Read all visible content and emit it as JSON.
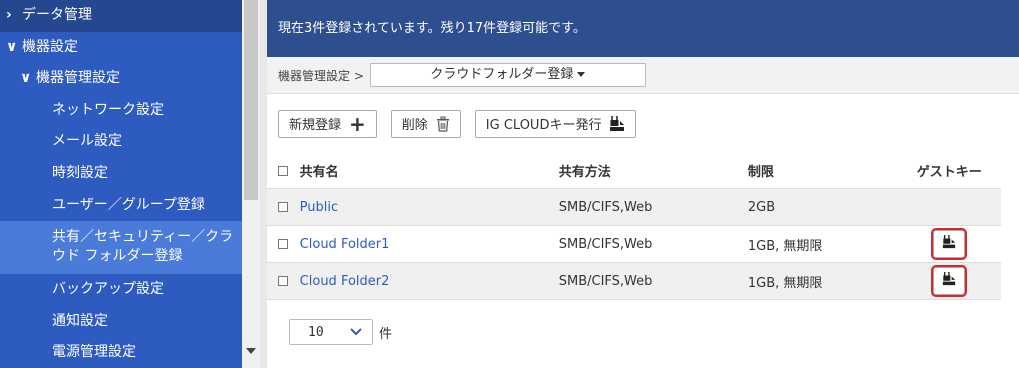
{
  "sidebar": {
    "items": [
      {
        "label": "データ管理",
        "chevron": "›"
      },
      {
        "label": "機器設定",
        "chevron": "∨"
      },
      {
        "label": "機器管理設定",
        "chevron": "∨"
      },
      {
        "label": "ネットワーク設定"
      },
      {
        "label": "メール設定"
      },
      {
        "label": "時刻設定"
      },
      {
        "label": "ユーザー／グループ登録"
      },
      {
        "label": "共有／セキュリティー／クラウド フォルダー登録"
      },
      {
        "label": "バックアップ設定"
      },
      {
        "label": "通知設定"
      },
      {
        "label": "電源管理設定"
      }
    ],
    "selected_index": 7
  },
  "banner": {
    "text": "現在3件登録されています。残り17件登録可能です。"
  },
  "breadcrumb": {
    "parent": "機器管理設定 >",
    "current": "クラウドフォルダー登録"
  },
  "toolbar": {
    "new_label": "新規登録",
    "new_icon": "+",
    "delete_label": "削除",
    "igcloud_label": "IG CLOUDキー発行"
  },
  "table": {
    "headers": {
      "name": "共有名",
      "method": "共有方法",
      "limit": "制限",
      "guest_key": "ゲストキー"
    },
    "rows": [
      {
        "name": "Public",
        "method": "SMB/CIFS,Web",
        "limit": "2GB",
        "has_key": false
      },
      {
        "name": "Cloud Folder1",
        "method": "SMB/CIFS,Web",
        "limit": "1GB, 無期限",
        "has_key": true
      },
      {
        "name": "Cloud Folder2",
        "method": "SMB/CIFS,Web",
        "limit": "1GB, 無期限",
        "has_key": true
      }
    ]
  },
  "pager": {
    "page_size": "10",
    "unit": "件"
  },
  "colors": {
    "sidebar_bg": "#2e5bbf",
    "banner_bg": "#2d4f8f",
    "link": "#2e5bbf",
    "highlight": "#d9252b"
  }
}
